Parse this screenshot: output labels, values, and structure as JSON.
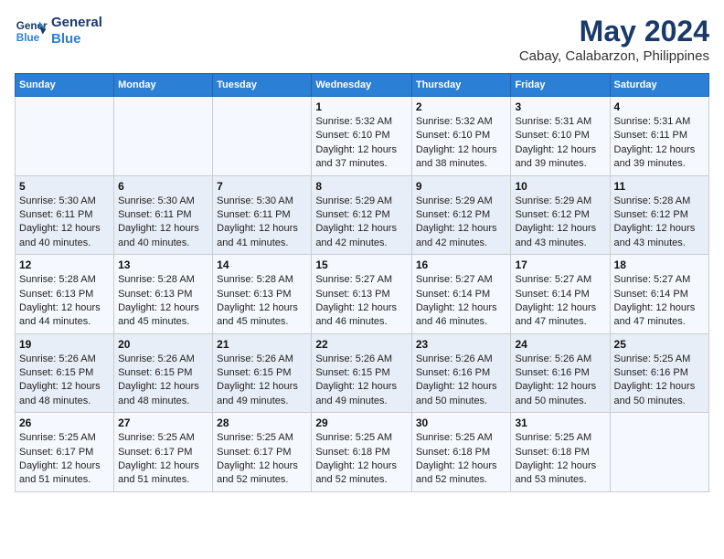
{
  "header": {
    "logo_line1": "General",
    "logo_line2": "Blue",
    "main_title": "May 2024",
    "subtitle": "Cabay, Calabarzon, Philippines"
  },
  "days_of_week": [
    "Sunday",
    "Monday",
    "Tuesday",
    "Wednesday",
    "Thursday",
    "Friday",
    "Saturday"
  ],
  "weeks": [
    [
      {
        "day": "",
        "info": ""
      },
      {
        "day": "",
        "info": ""
      },
      {
        "day": "",
        "info": ""
      },
      {
        "day": "1",
        "info": "Sunrise: 5:32 AM\nSunset: 6:10 PM\nDaylight: 12 hours\nand 37 minutes."
      },
      {
        "day": "2",
        "info": "Sunrise: 5:32 AM\nSunset: 6:10 PM\nDaylight: 12 hours\nand 38 minutes."
      },
      {
        "day": "3",
        "info": "Sunrise: 5:31 AM\nSunset: 6:10 PM\nDaylight: 12 hours\nand 39 minutes."
      },
      {
        "day": "4",
        "info": "Sunrise: 5:31 AM\nSunset: 6:11 PM\nDaylight: 12 hours\nand 39 minutes."
      }
    ],
    [
      {
        "day": "5",
        "info": "Sunrise: 5:30 AM\nSunset: 6:11 PM\nDaylight: 12 hours\nand 40 minutes."
      },
      {
        "day": "6",
        "info": "Sunrise: 5:30 AM\nSunset: 6:11 PM\nDaylight: 12 hours\nand 40 minutes."
      },
      {
        "day": "7",
        "info": "Sunrise: 5:30 AM\nSunset: 6:11 PM\nDaylight: 12 hours\nand 41 minutes."
      },
      {
        "day": "8",
        "info": "Sunrise: 5:29 AM\nSunset: 6:12 PM\nDaylight: 12 hours\nand 42 minutes."
      },
      {
        "day": "9",
        "info": "Sunrise: 5:29 AM\nSunset: 6:12 PM\nDaylight: 12 hours\nand 42 minutes."
      },
      {
        "day": "10",
        "info": "Sunrise: 5:29 AM\nSunset: 6:12 PM\nDaylight: 12 hours\nand 43 minutes."
      },
      {
        "day": "11",
        "info": "Sunrise: 5:28 AM\nSunset: 6:12 PM\nDaylight: 12 hours\nand 43 minutes."
      }
    ],
    [
      {
        "day": "12",
        "info": "Sunrise: 5:28 AM\nSunset: 6:13 PM\nDaylight: 12 hours\nand 44 minutes."
      },
      {
        "day": "13",
        "info": "Sunrise: 5:28 AM\nSunset: 6:13 PM\nDaylight: 12 hours\nand 45 minutes."
      },
      {
        "day": "14",
        "info": "Sunrise: 5:28 AM\nSunset: 6:13 PM\nDaylight: 12 hours\nand 45 minutes."
      },
      {
        "day": "15",
        "info": "Sunrise: 5:27 AM\nSunset: 6:13 PM\nDaylight: 12 hours\nand 46 minutes."
      },
      {
        "day": "16",
        "info": "Sunrise: 5:27 AM\nSunset: 6:14 PM\nDaylight: 12 hours\nand 46 minutes."
      },
      {
        "day": "17",
        "info": "Sunrise: 5:27 AM\nSunset: 6:14 PM\nDaylight: 12 hours\nand 47 minutes."
      },
      {
        "day": "18",
        "info": "Sunrise: 5:27 AM\nSunset: 6:14 PM\nDaylight: 12 hours\nand 47 minutes."
      }
    ],
    [
      {
        "day": "19",
        "info": "Sunrise: 5:26 AM\nSunset: 6:15 PM\nDaylight: 12 hours\nand 48 minutes."
      },
      {
        "day": "20",
        "info": "Sunrise: 5:26 AM\nSunset: 6:15 PM\nDaylight: 12 hours\nand 48 minutes."
      },
      {
        "day": "21",
        "info": "Sunrise: 5:26 AM\nSunset: 6:15 PM\nDaylight: 12 hours\nand 49 minutes."
      },
      {
        "day": "22",
        "info": "Sunrise: 5:26 AM\nSunset: 6:15 PM\nDaylight: 12 hours\nand 49 minutes."
      },
      {
        "day": "23",
        "info": "Sunrise: 5:26 AM\nSunset: 6:16 PM\nDaylight: 12 hours\nand 50 minutes."
      },
      {
        "day": "24",
        "info": "Sunrise: 5:26 AM\nSunset: 6:16 PM\nDaylight: 12 hours\nand 50 minutes."
      },
      {
        "day": "25",
        "info": "Sunrise: 5:25 AM\nSunset: 6:16 PM\nDaylight: 12 hours\nand 50 minutes."
      }
    ],
    [
      {
        "day": "26",
        "info": "Sunrise: 5:25 AM\nSunset: 6:17 PM\nDaylight: 12 hours\nand 51 minutes."
      },
      {
        "day": "27",
        "info": "Sunrise: 5:25 AM\nSunset: 6:17 PM\nDaylight: 12 hours\nand 51 minutes."
      },
      {
        "day": "28",
        "info": "Sunrise: 5:25 AM\nSunset: 6:17 PM\nDaylight: 12 hours\nand 52 minutes."
      },
      {
        "day": "29",
        "info": "Sunrise: 5:25 AM\nSunset: 6:18 PM\nDaylight: 12 hours\nand 52 minutes."
      },
      {
        "day": "30",
        "info": "Sunrise: 5:25 AM\nSunset: 6:18 PM\nDaylight: 12 hours\nand 52 minutes."
      },
      {
        "day": "31",
        "info": "Sunrise: 5:25 AM\nSunset: 6:18 PM\nDaylight: 12 hours\nand 53 minutes."
      },
      {
        "day": "",
        "info": ""
      }
    ]
  ]
}
